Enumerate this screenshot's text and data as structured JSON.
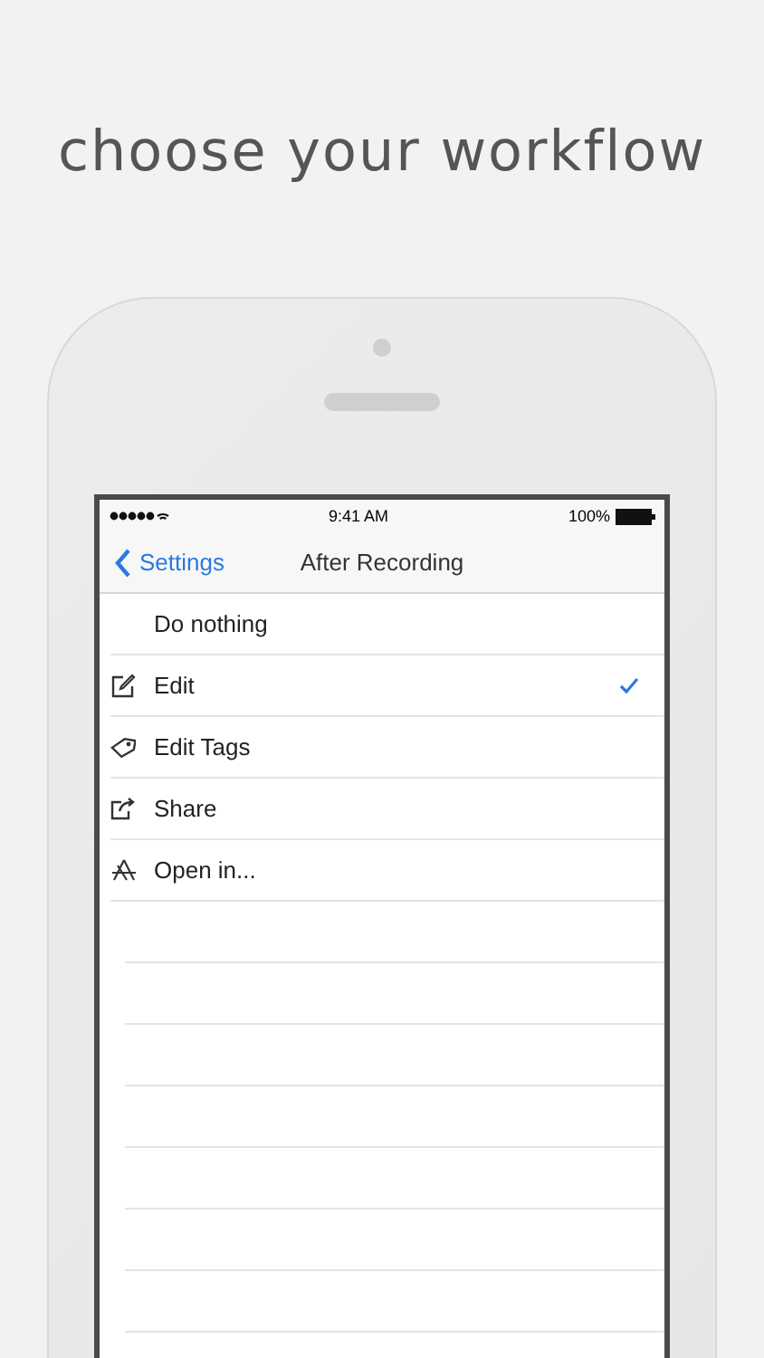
{
  "headline": "choose your workflow",
  "status_bar": {
    "time": "9:41 AM",
    "battery": "100%"
  },
  "nav": {
    "back": "Settings",
    "title": "After Recording"
  },
  "options": [
    {
      "label": "Do nothing",
      "kind": "none",
      "selected": false
    },
    {
      "label": "Edit",
      "kind": "pencil",
      "selected": true
    },
    {
      "label": "Edit Tags",
      "kind": "tag",
      "selected": false
    },
    {
      "label": "Share",
      "kind": "share",
      "selected": false
    },
    {
      "label": "Open in...",
      "kind": "apps",
      "selected": false
    }
  ]
}
